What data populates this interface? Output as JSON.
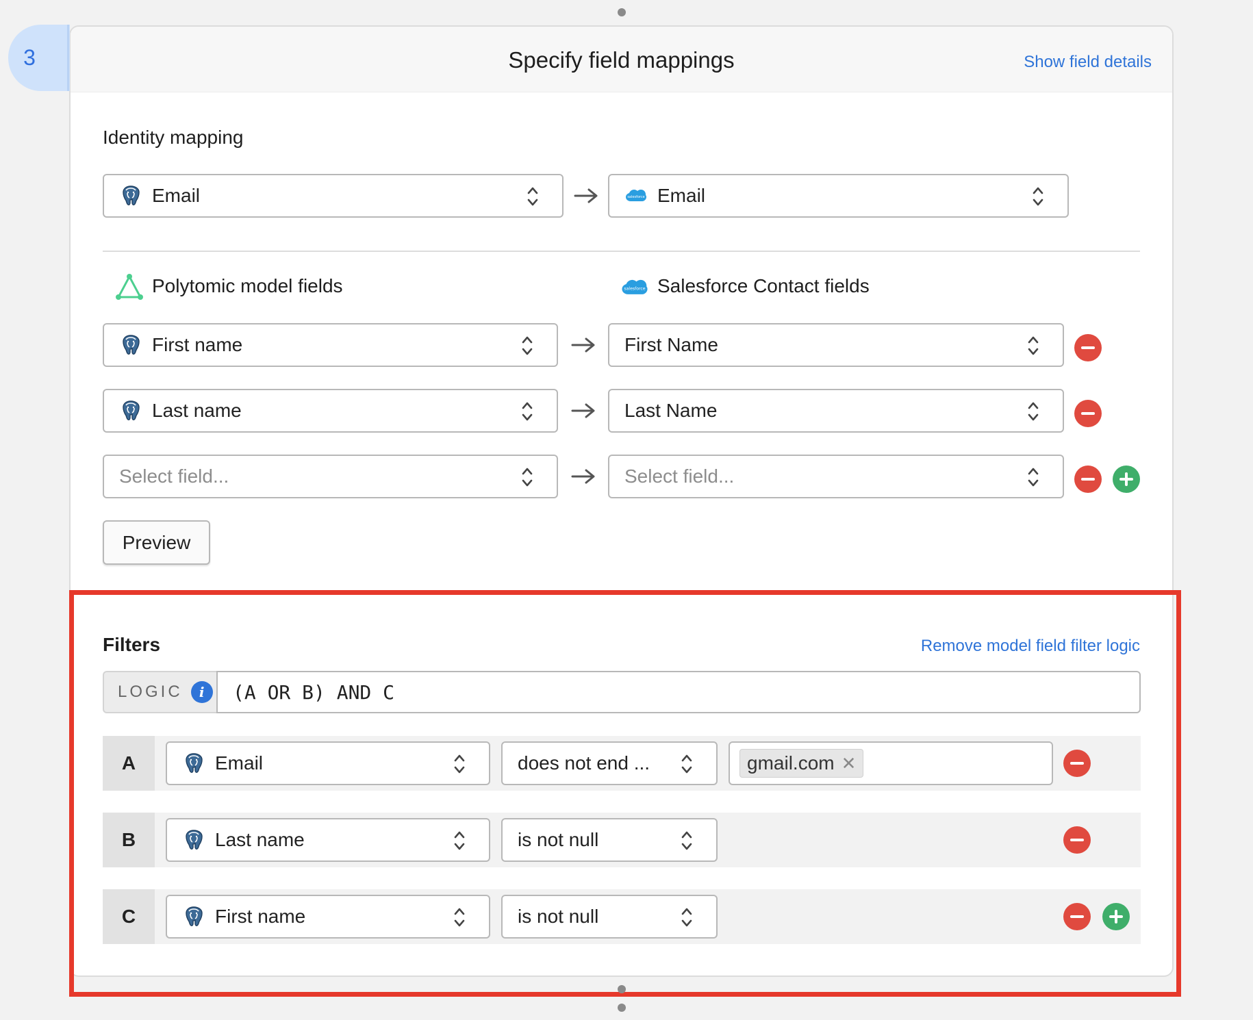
{
  "step": {
    "number": "3",
    "title": "Specify field mappings",
    "show_details_link": "Show field details"
  },
  "identity": {
    "label": "Identity mapping",
    "source": {
      "value": "Email",
      "icon": "postgres-icon"
    },
    "target": {
      "value": "Email",
      "icon": "salesforce-icon"
    }
  },
  "mappings": {
    "source_header": "Polytomic model fields",
    "target_header": "Salesforce Contact fields",
    "rows": [
      {
        "source": "First name",
        "target": "First Name"
      },
      {
        "source": "Last name",
        "target": "Last Name"
      },
      {
        "source_placeholder": "Select field...",
        "target_placeholder": "Select field..."
      }
    ],
    "preview_label": "Preview"
  },
  "filters": {
    "label": "Filters",
    "remove_logic_link": "Remove model field filter logic",
    "logic_label": "LOGIC",
    "logic_value": "(A OR B) AND C",
    "rows": [
      {
        "letter": "A",
        "field": "Email",
        "operator": "does not end ...",
        "values": [
          "gmail.com"
        ]
      },
      {
        "letter": "B",
        "field": "Last name",
        "operator": "is not null"
      },
      {
        "letter": "C",
        "field": "First name",
        "operator": "is not null"
      }
    ]
  },
  "colors": {
    "accent": "#2f74d8",
    "remove": "#e04a3f",
    "add": "#3fae6a",
    "highlight": "#e6392b",
    "step_pill": "#cfe2fb"
  }
}
